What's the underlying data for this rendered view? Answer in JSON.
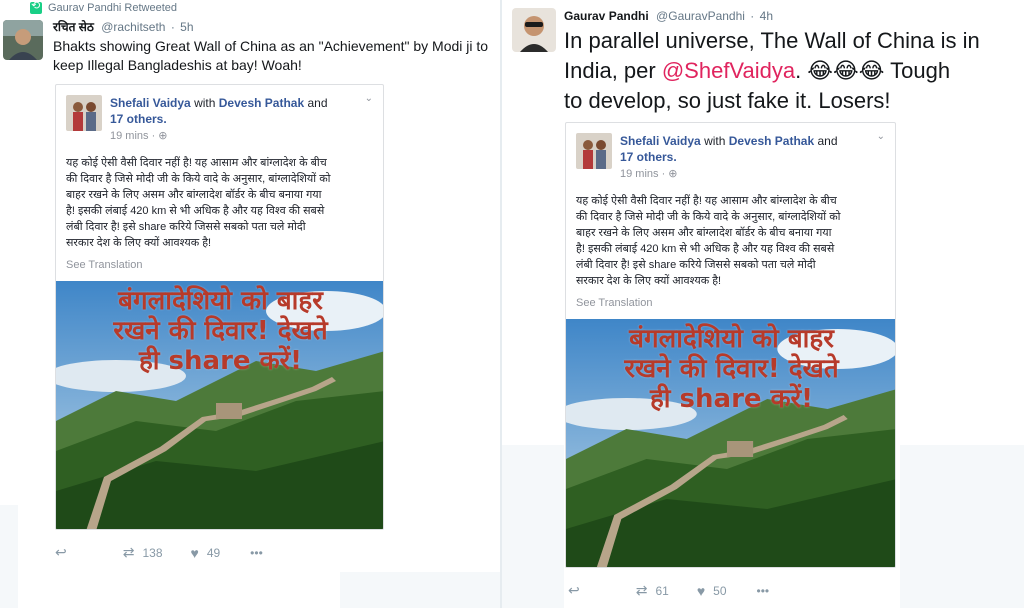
{
  "left_tweet": {
    "retweet_label": "Gaurav Pandhi Retweeted",
    "author_name": "रचित सेठ",
    "author_handle": "@rachitseth",
    "time": "5h",
    "text_line1": "Bhakts showing Great Wall of China as an \"Achievement\" by Modi ji to",
    "text_line2": "keep Illegal Bangladeshis at bay! Woah!",
    "actions": {
      "retweets": "138",
      "likes": "49",
      "more": "•••"
    }
  },
  "right_tweet": {
    "author_name": "Gaurav Pandhi",
    "author_handle": "@GauravPandhi",
    "time": "4h",
    "text_line1": "In parallel universe, The Wall of China is in",
    "text_line2_before": "India, per ",
    "mention": "@ShefVaidya",
    "text_line2_after": ". 😂😂😂 Tough",
    "text_line3": "to develop, so just fake it. Losers!",
    "actions": {
      "retweets": "61",
      "likes": "50",
      "more": "•••"
    }
  },
  "fb_post": {
    "author": "Shefali Vaidya",
    "with_text": "with",
    "tagged": "Devesh Pathak",
    "and_text": "and",
    "others": "17 others.",
    "time": "19 mins · ",
    "body_lines": [
      "यह कोई ऐसी वैसी दिवार नहीं है! यह आसाम और बांग्लादेश के बीच",
      "की दिवार है जिसे मोदी जी के किये वादे के अनुसार, बांग्लादेशियों को",
      "बाहर रखने के लिए असम और बांग्लादेश बॉर्डर के बीच बनाया गया",
      "है! इसकी लंबाई 420 km से भी अधिक है और यह विश्व की सबसे",
      "लंबी दिवार है! इसे share करिये जिससे सबको पता चले मोदी",
      "सरकार देश के लिए क्यों आवश्यक है!"
    ],
    "see_translation": "See Translation",
    "image_caption_lines": [
      "बंगलादेशियो को बाहर",
      "रखने की दिवार! देखते",
      "ही share करें!"
    ]
  },
  "colors": {
    "mention": "#e0245e",
    "fb_link": "#365899",
    "caption": "#b73a2a",
    "muted": "#657786"
  }
}
